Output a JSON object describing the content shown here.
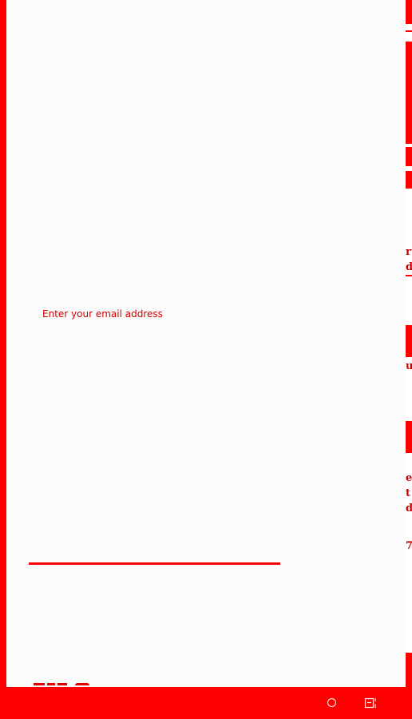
{
  "form": {
    "email_label": "Enter your email address",
    "email_value": ""
  },
  "right_panel": {
    "glyphs": [
      "rt",
      "d",
      "u",
      "e",
      "t",
      "d",
      "7"
    ]
  },
  "navigation_bar": {
    "buttons": [
      "home",
      "recent-apps"
    ]
  },
  "colors": {
    "accent": "#ff0000",
    "label": "#d40000",
    "background": "#fbfbfb",
    "nav_icon": "#ffffff"
  },
  "icons": {
    "home": "circle-icon",
    "recent_apps": "recents-icon"
  }
}
